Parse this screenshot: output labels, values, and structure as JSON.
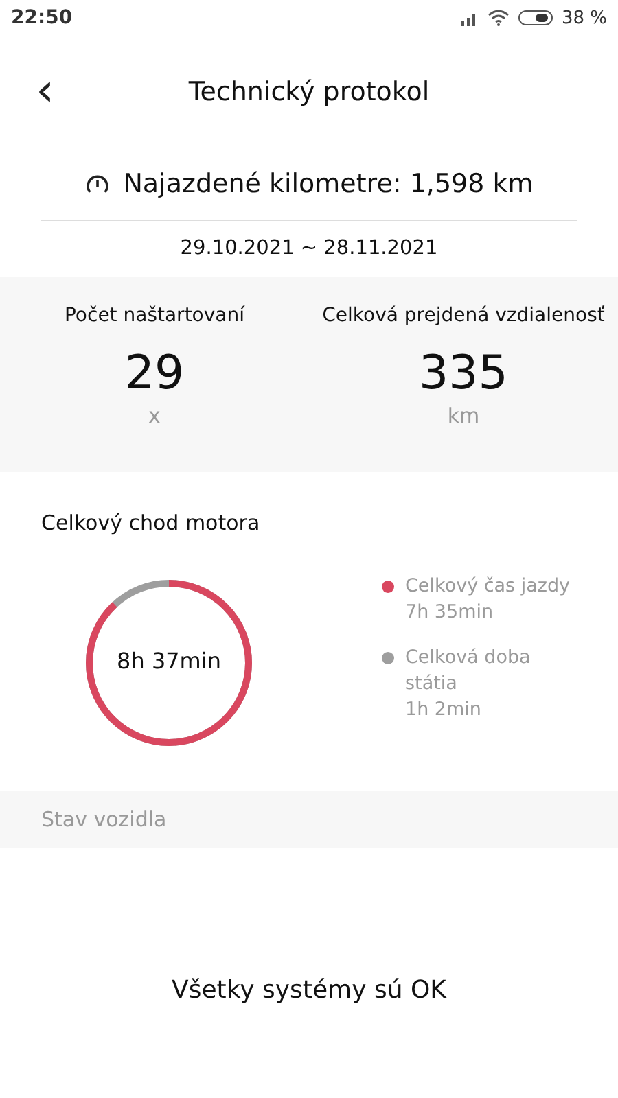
{
  "status_bar": {
    "time": "22:50",
    "battery": "38 %"
  },
  "header": {
    "back": "‹",
    "title": "Technický protokol"
  },
  "odometer": {
    "text": "Najazdené kilometre: 1,598 km"
  },
  "date_range": "29.10.2021 ~ 28.11.2021",
  "stats": [
    {
      "label": "Počet naštartovaní",
      "value": "29",
      "unit": "x"
    },
    {
      "label": "Celková prejdená vzdialenosť",
      "value": "335",
      "unit": "km"
    }
  ],
  "engine": {
    "title": "Celkový chod motora",
    "total": "8h 37min",
    "ring": {
      "level": 0.88
    },
    "legend": [
      {
        "label": "Celkový čas jazdy",
        "value": "7h 35min",
        "color": "#d9475f"
      },
      {
        "label": "Celková doba státia",
        "value": "1h 2min",
        "color": "#9e9e9e"
      }
    ]
  },
  "vehicle_state": {
    "title": "Stav vozidla",
    "message": "Všetky systémy sú OK"
  }
}
